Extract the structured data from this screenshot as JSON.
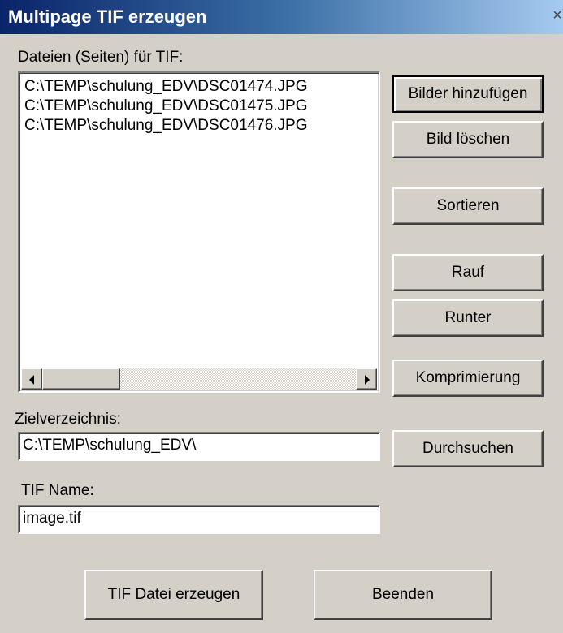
{
  "window": {
    "title": "Multipage TIF erzeugen",
    "close_glyph": "×"
  },
  "files": {
    "label": "Dateien (Seiten) für TIF:",
    "items": [
      "C:\\TEMP\\schulung_EDV\\DSC01474.JPG",
      "C:\\TEMP\\schulung_EDV\\DSC01475.JPG",
      "C:\\TEMP\\schulung_EDV\\DSC01476.JPG"
    ]
  },
  "buttons": {
    "add": "Bilder hinzufügen",
    "delete": "Bild löschen",
    "sort": "Sortieren",
    "up": "Rauf",
    "down": "Runter",
    "compress": "Komprimierung",
    "browse": "Durchsuchen",
    "create": "TIF Datei erzeugen",
    "exit": "Beenden"
  },
  "target": {
    "label": "Zielverzeichnis:",
    "value": "C:\\TEMP\\schulung_EDV\\"
  },
  "tifname": {
    "label": "TIF Name:",
    "value": "image.tif"
  },
  "colors": {
    "titlebar_start": "#0a246a",
    "titlebar_end": "#a6caf0",
    "dialog_bg": "#d4d0c8"
  }
}
